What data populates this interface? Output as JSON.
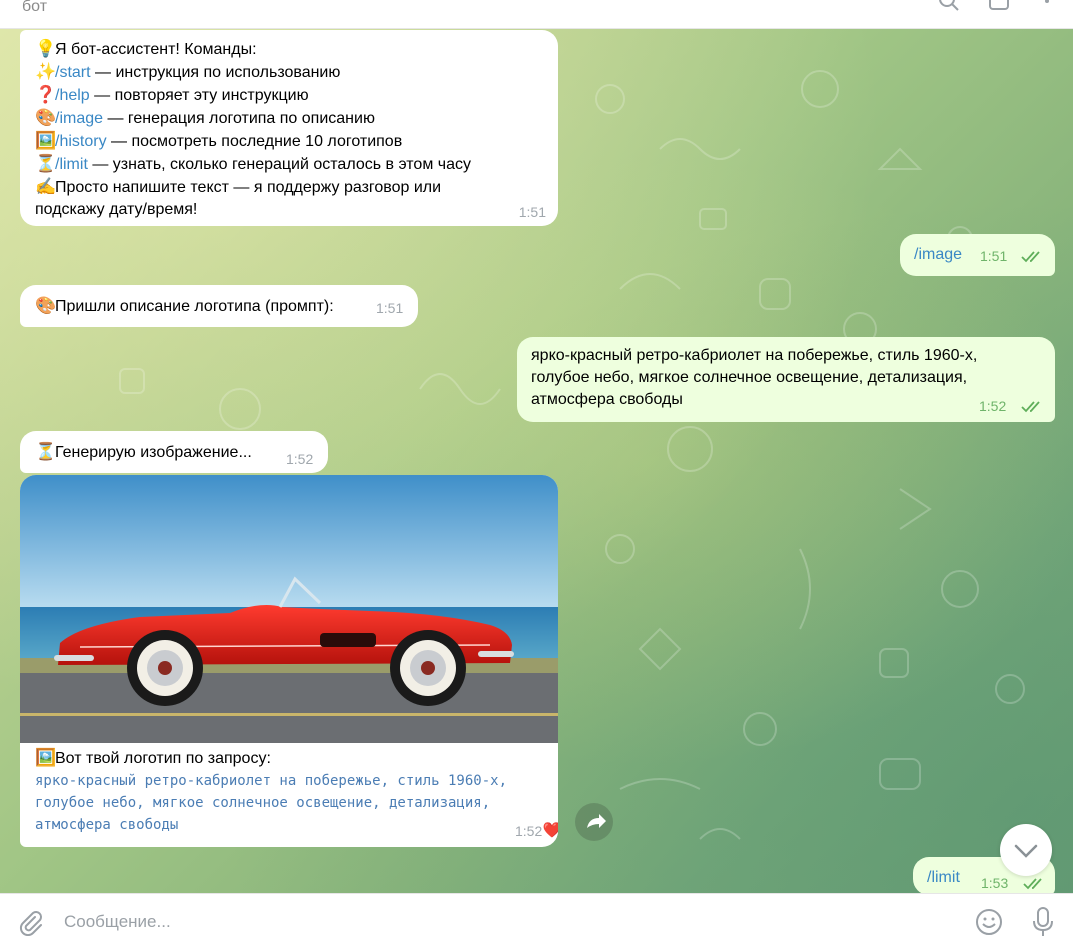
{
  "header": {
    "title": "бот"
  },
  "messages": {
    "commands": {
      "intro": "Я бот-ассистент! Команды:",
      "start_cmd": "/start",
      "start_desc": " — инструкция по использованию",
      "help_cmd": "/help",
      "help_desc": " — повторяет эту инструкцию",
      "image_cmd": "/image",
      "image_desc": " — генерация логотипа по описанию",
      "history_cmd": "/history",
      "history_desc": " — посмотреть последние 10 логотипов",
      "limit_cmd": "/limit",
      "limit_desc": " — узнать, сколько генераций осталось в этом часу",
      "chat_line1": "Просто напишите текст — я поддержу разговор или",
      "chat_line2": "подскажу дату/время!",
      "time": "1:51"
    },
    "out_image": {
      "text": "/image",
      "time": "1:51"
    },
    "send_prompt": {
      "text": "Пришли описание логотипа (промпт):",
      "time": "1:51"
    },
    "out_prompt": {
      "line1": "ярко-красный ретро-кабриолет на побережье, стиль 1960-х,",
      "line2": "голубое небо, мягкое солнечное освещение, детализация,",
      "line3": "атмосфера свободы",
      "time": "1:52"
    },
    "generating": {
      "text": "Генерирую изображение...",
      "time": "1:52"
    },
    "result": {
      "caption": "Вот твой логотип по запросу:",
      "line1": "ярко-красный ретро-кабриолет на побережье, стиль 1960-х,",
      "line2": "голубое небо, мягкое солнечное освещение, детализация,",
      "line3": "атмосфера свободы",
      "time": "1:52",
      "reaction": "❤️"
    },
    "out_limit": {
      "text": "/limit",
      "time": "1:53"
    }
  },
  "composer": {
    "placeholder": "Сообщение..."
  },
  "colors": {
    "link": "#3a88c5",
    "out_bubble": "#eeffde",
    "in_bubble": "#ffffff",
    "read_ticks": "#5fae5a"
  }
}
